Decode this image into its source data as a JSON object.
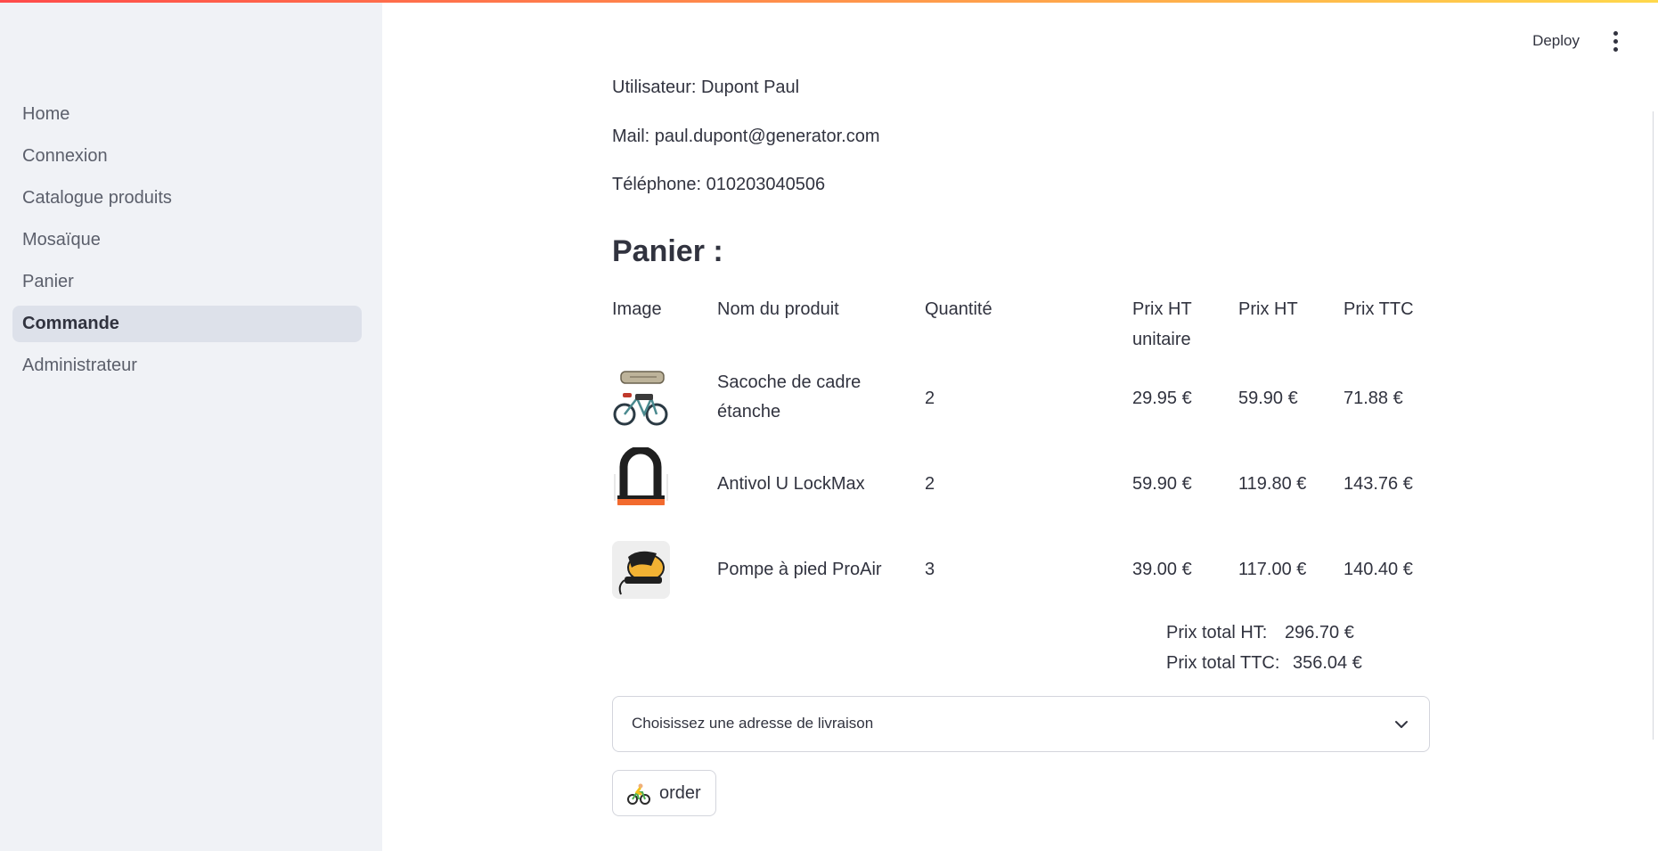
{
  "header": {
    "deploy_label": "Deploy"
  },
  "sidebar": {
    "items": [
      {
        "label": "Home",
        "active": false
      },
      {
        "label": "Connexion",
        "active": false
      },
      {
        "label": "Catalogue produits",
        "active": false
      },
      {
        "label": "Mosaïque",
        "active": false
      },
      {
        "label": "Panier",
        "active": false
      },
      {
        "label": "Commande",
        "active": true
      },
      {
        "label": "Administrateur",
        "active": false
      }
    ]
  },
  "user": {
    "name_line": "Utilisateur: Dupont Paul",
    "mail_line": "Mail: paul.dupont@generator.com",
    "phone_line": "Téléphone: 010203040506"
  },
  "cart": {
    "title": "Panier :",
    "columns": {
      "image": "Image",
      "name": "Nom du produit",
      "qty": "Quantité",
      "unit_ht_1": "Prix HT",
      "unit_ht_2": "unitaire",
      "total_ht": "Prix HT",
      "total_ttc": "Prix TTC"
    },
    "rows": [
      {
        "name_line1": "Sacoche de cadre",
        "name_line2": "étanche",
        "qty": "2",
        "unit_ht": "29.95 €",
        "total_ht": "59.90 €",
        "total_ttc": "71.88 €",
        "image_icon": "bike-bag-image"
      },
      {
        "name_line1": "Antivol U LockMax",
        "qty": "2",
        "unit_ht": "59.90 €",
        "total_ht": "119.80 €",
        "total_ttc": "143.76 €",
        "image_icon": "u-lock-image"
      },
      {
        "name_line1": "Pompe à pied ProAir",
        "qty": "3",
        "unit_ht": "39.00 €",
        "total_ht": "117.00 €",
        "total_ttc": "140.40 €",
        "image_icon": "foot-pump-image"
      }
    ],
    "totals": {
      "ht_label": "Prix total HT:",
      "ht_value": "296.70 €",
      "ttc_label": "Prix total TTC:",
      "ttc_value": "356.04 €"
    }
  },
  "address_select": {
    "placeholder": "Choisissez une adresse de livraison"
  },
  "order_button": {
    "label": "order",
    "icon": "bicyclist-icon"
  },
  "colors": {
    "sidebar_bg": "#f0f2f6",
    "active_item_bg": "#dde1ea",
    "text": "#31333f",
    "accent_gradient_start": "#ff4b4b",
    "accent_gradient_end": "#ffd84b"
  }
}
